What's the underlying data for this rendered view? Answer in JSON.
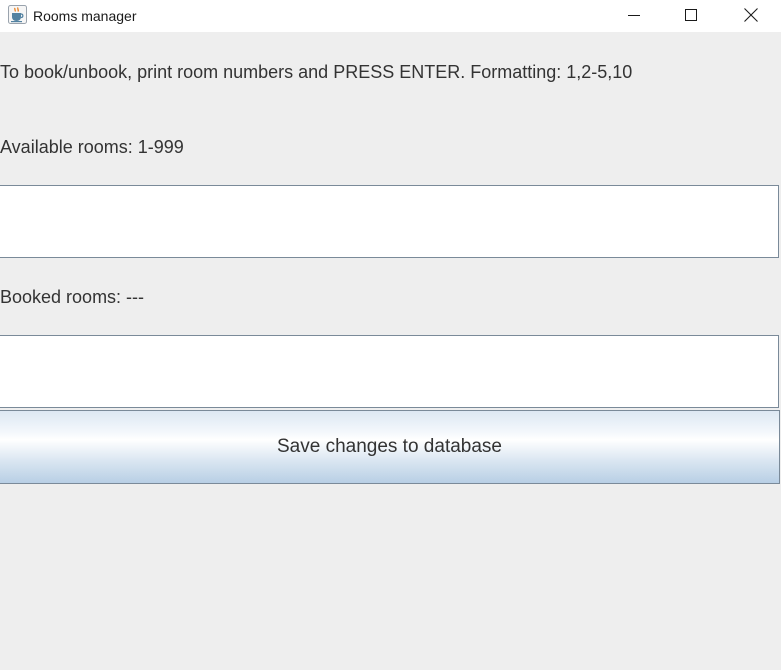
{
  "window": {
    "title": "Rooms manager",
    "icon": "java-coffee-cup-icon",
    "controls": {
      "minimize_icon": "minimize-icon",
      "maximize_icon": "maximize-icon",
      "close_icon": "close-icon"
    }
  },
  "main": {
    "instructions": "To book/unbook, print room numbers and PRESS ENTER. Formatting: 1,2-5,10",
    "available_label": "Available rooms: 1-999",
    "available_input_value": "",
    "booked_label": "Booked rooms: ---",
    "booked_input_value": "",
    "save_button_label": "Save changes to database"
  },
  "colors": {
    "background": "#eeeeee",
    "titlebar": "#ffffff",
    "field_border": "#7a8a99",
    "button_gradient_top": "#dde8f3",
    "button_gradient_bottom": "#b8cfe5",
    "text": "#333333"
  }
}
